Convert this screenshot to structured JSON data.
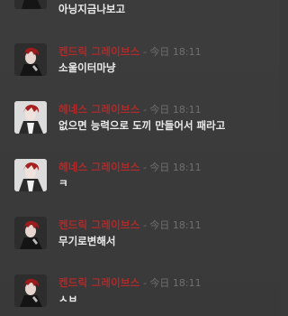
{
  "messages": [
    {
      "id": "m0",
      "author": "",
      "time": "",
      "content": "아닝지금나보고",
      "avatar": "dark-hair-figure",
      "continued": true
    },
    {
      "id": "m1",
      "author": "켄드릭 그레이브스",
      "sep": " - ",
      "time": "今日 18:11",
      "content": "소울이터마냥",
      "avatar": "dark-hair-figure"
    },
    {
      "id": "m2",
      "author": "헤네스 그레이브스",
      "sep": " - ",
      "time": "今日 18:11",
      "content": "없으면 능력으로 도끼 만들어서 패라고",
      "avatar": "light-figure"
    },
    {
      "id": "m3",
      "author": "헤네스 그레이브스",
      "sep": " - ",
      "time": "今日 18:11",
      "content": "ㅋ",
      "avatar": "light-figure"
    },
    {
      "id": "m4",
      "author": "켄드릭 그레이브스",
      "sep": " - ",
      "time": "今日 18:11",
      "content": "무기로변해서",
      "avatar": "dark-hair-figure"
    },
    {
      "id": "m5",
      "author": "켄드릭 그레이브스",
      "sep": " - ",
      "time": "今日 18:11",
      "content": "ㅅㅂ",
      "avatar": "dark-hair-figure"
    }
  ],
  "colors": {
    "background": "#3a3a3a",
    "author": "#b02a2a",
    "timestamp": "#6f6f6f",
    "text": "#eaeaea"
  }
}
